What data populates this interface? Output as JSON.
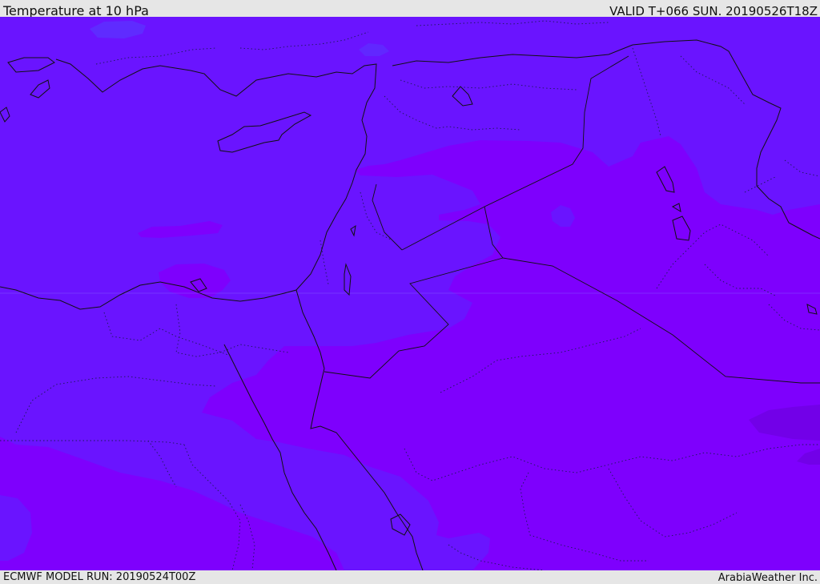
{
  "header": {
    "title": "Temperature at 10 hPa",
    "valid": "VALID T+066 SUN. 20190526T18Z"
  },
  "footer": {
    "model_run": "ECMWF MODEL RUN: 20190524T00Z",
    "credit": "ArabiaWeather Inc."
  },
  "colors": {
    "band_cool": "#6a14ff",
    "band_warm": "#7e00fd",
    "band_warmest": "#7200e8",
    "coastline": "#111111",
    "border_dotted": "#1a1a55"
  }
}
